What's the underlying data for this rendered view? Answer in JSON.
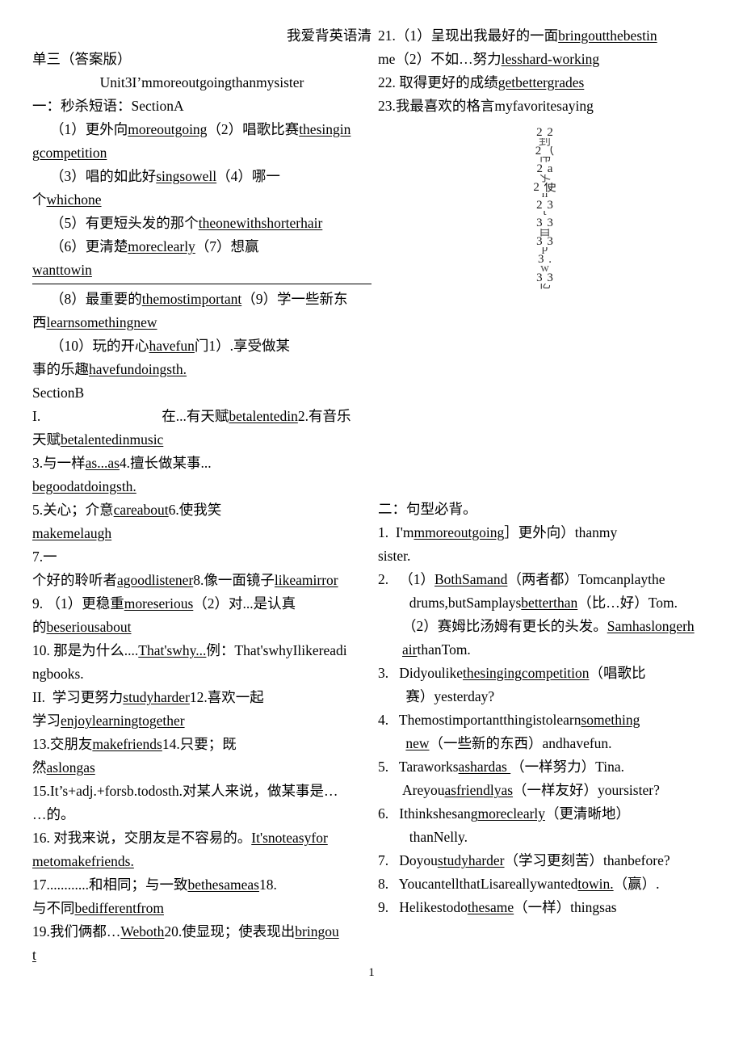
{
  "document": {
    "header_right": "我爱背英语清",
    "header_left": "单三（答案版）",
    "unit_title": "Unit3I’mmoreoutgoingthanmysister",
    "page_number": "1"
  },
  "left_column": {
    "section_heading": "一：秒杀短语：SectionA",
    "lines": [
      "（1）更外向moreoutgoing（2）唱歌比赛thesingin",
      "gcompetition",
      "（3）唱的如此好singsowell（4）哪一",
      "个whichone",
      "（5）有更短头发的那个theonewithshorterhair",
      "（6）更清楚moreclearly（7）想赢",
      "wanttowin",
      "（8）最重要的themostimportant（9）学一些新东",
      "西learnsomethingnew",
      "（10）玩的开心havefun门1）.享受做某",
      "事的乐趣havefundoingsth.",
      "SectionB",
      "在...有天赋betalentedin2.有音乐",
      "天赋betalentedinmusic",
      "3.与一样as...as4.擅长做某事...",
      "begoodatdoingsth.",
      "5.关心；介意careabout6.使我笑",
      "makemelaugh",
      "7.一",
      "个好的聆听者agoodlistener8.像一面镜子likeamirror",
      "9.（1）更稳重moreserious（2）对...是认真",
      "的beseriousabout",
      "10. 那是为什么....That'swhy...例：That'swhyIlikereadi",
      "ngbooks.",
      "学习更努力studyharder12.喜欢一起",
      "学习enjoylearningtogether",
      "13.交朋友makefriends14.只要；既",
      "然aslongas",
      "15.It’s+adj.+forsb.todosth.对某人来说，做某事是…",
      "…的。",
      "16. 对我来说，交朋友是不容易的。It'snoteasyfor",
      "metomakefriends.",
      "17............和相同；与一致bethesameas18.",
      "与不同bedifferentfrom",
      "19.我们俩都…Weboth20.使显现；使表现出bringou",
      "t"
    ],
    "marker_I": "I.",
    "marker_II": "II."
  },
  "right_column": {
    "item21": "21.（1）呈现出我最好的一面bringoutthebestin",
    "item21b": "me（2）不如…努力lesshard-working",
    "item22": "22. 取得更好的成绩getbettergrades",
    "item23": "23.我最喜欢的格言myfavoritesaying",
    "section_heading": "二：句型必背。",
    "sentences": [
      "1. I'mmoreoutgoing］更外向）thanmy",
      "sister.",
      "2. （1）BothSamand（两者都）Tomcanplaythe",
      "drums,butSamplaysbetterthan（比…好）Tom.",
      "（2）赛姆比汤姆有更长的头发。Samhaslongerh",
      "airthanTom.",
      "3. Didyoulikethesingingcompetition（唱歌比",
      "赛）yesterday?",
      "4. Themostimportantthingistolearnsomething",
      "new（一些新的东西）andhavefun.",
      "5. Taraworksashardas（一样努力）Tina.",
      "Areyouasfriendlyas（一样友好）yoursister?",
      "6. Ithinkshesangmoreclearly（更清晰地）",
      "thanNelly.",
      "7. Doyoustudyharder（学习更刻苦）thanbefore?",
      "8. YoucantellthatLisareallywantedtowin.（赢）.",
      "9. Helikestodothesame（一样）thingsas"
    ],
    "garbled_column": [
      "2 2",
      "刲",
      "2（",
      "伟",
      "2 a",
      "孓",
      "2 使",
      "n",
      "2 3",
      "t",
      "3 3",
      "自",
      "3 3",
      "p",
      "3 .",
      "w",
      "3 3",
      "亿"
    ]
  },
  "colors": {
    "text": "#000000",
    "background": "#ffffff",
    "rule": "#000000"
  }
}
